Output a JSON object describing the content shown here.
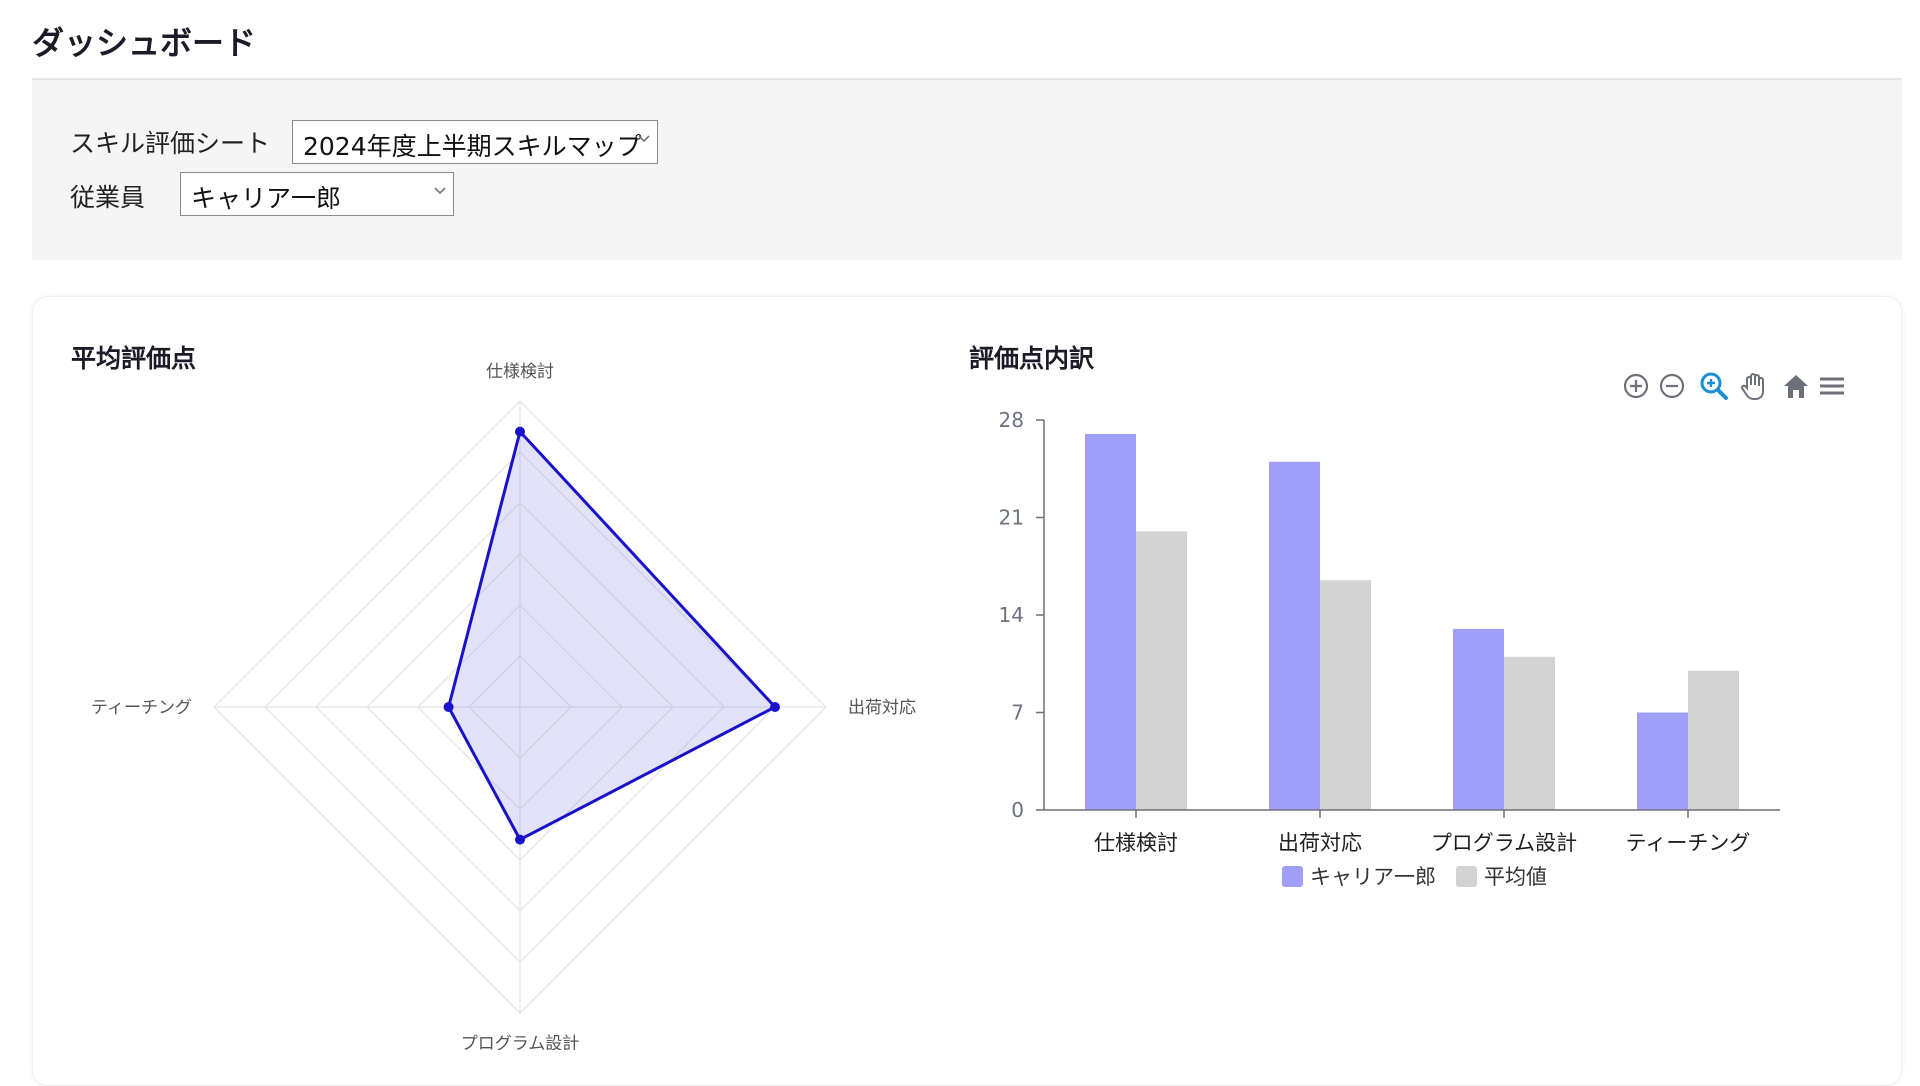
{
  "header": {
    "title": "ダッシュボード"
  },
  "filters": {
    "sheet_label": "スキル評価シート",
    "sheet_value": "2024年度上半期スキルマップ",
    "employee_label": "従業員",
    "employee_value": "キャリア一郎"
  },
  "radar": {
    "title": "平均評価点",
    "axes": [
      "仕様検討",
      "出荷対応",
      "プログラム設計",
      "ティーチング"
    ],
    "values": [
      27,
      25,
      13,
      7
    ],
    "max": 30,
    "color": "#1a12c8",
    "fill": "rgba(140,140,235,0.25)"
  },
  "bar": {
    "title": "評価点内訳",
    "toolbar_icons": [
      "zoom-in-icon",
      "zoom-out-icon",
      "magnifier-icon",
      "pan-hand-icon",
      "home-icon",
      "menu-icon"
    ]
  },
  "chart_data": [
    {
      "type": "radar",
      "title": "平均評価点",
      "categories": [
        "仕様検討",
        "出荷対応",
        "プログラム設計",
        "ティーチング"
      ],
      "series": [
        {
          "name": "キャリア一郎",
          "values": [
            27,
            25,
            13,
            7
          ]
        }
      ]
    },
    {
      "type": "bar",
      "title": "評価点内訳",
      "categories": [
        "仕様検討",
        "出荷対応",
        "プログラム設計",
        "ティーチング"
      ],
      "series": [
        {
          "name": "キャリア一郎",
          "values": [
            27,
            25,
            13,
            7
          ],
          "color": "#a0a0fa"
        },
        {
          "name": "平均値",
          "values": [
            20,
            16.5,
            11,
            10
          ],
          "color": "#d3d3d3"
        }
      ],
      "yticks": [
        0,
        7,
        14,
        21,
        28
      ],
      "ylim": [
        0,
        28
      ],
      "legend": "bottom"
    }
  ]
}
